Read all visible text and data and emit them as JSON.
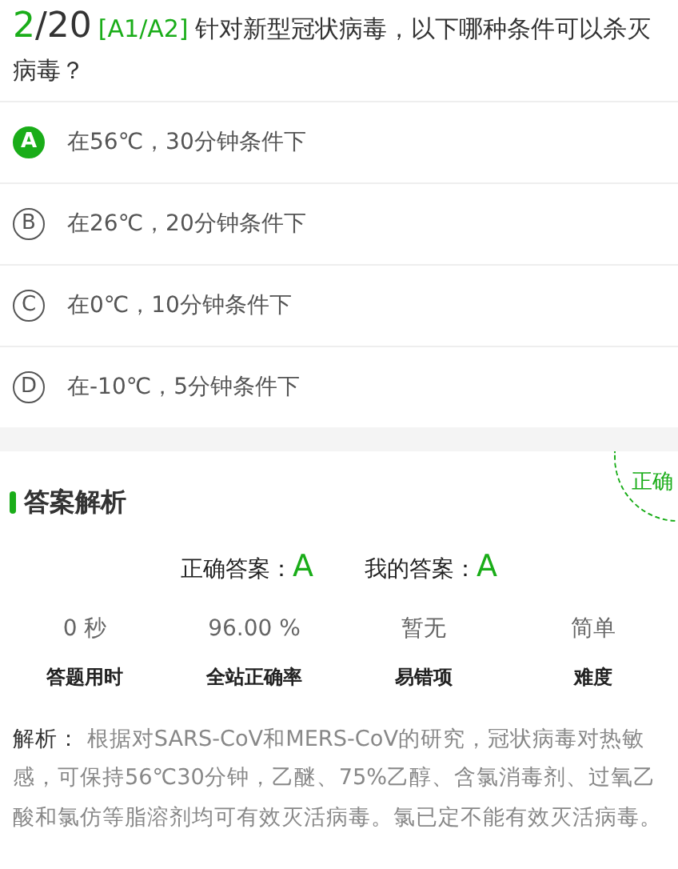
{
  "question": {
    "index": "2",
    "total": "/20",
    "type": "[A1/A2]",
    "text": "针对新型冠状病毒，以下哪种条件可以杀灭病毒？"
  },
  "options": [
    {
      "letter": "A",
      "text": "在56℃，30分钟条件下",
      "selected": true
    },
    {
      "letter": "B",
      "text": "在26℃，20分钟条件下",
      "selected": false
    },
    {
      "letter": "C",
      "text": "在0℃，10分钟条件下",
      "selected": false
    },
    {
      "letter": "D",
      "text": "在-10℃，5分钟条件下",
      "selected": false
    }
  ],
  "analysis": {
    "title": "答案解析",
    "stamp": "正确",
    "correct_label": "正确答案：",
    "correct": "A",
    "mine_label": "我的答案：",
    "mine": "A",
    "stats": [
      {
        "value": "0 秒",
        "label": "答题用时"
      },
      {
        "value": "96.00 %",
        "label": "全站正确率"
      },
      {
        "value": "暂无",
        "label": "易错项"
      },
      {
        "value": "简单",
        "label": "难度"
      }
    ],
    "explain_label": "解析：",
    "explain": "根据对SARS-CoV和MERS-CoV的研究，冠状病毒对热敏感，可保持56℃30分钟，乙醚、75%乙醇、含氯消毒剂、过氧乙酸和氯仿等脂溶剂均可有效灭活病毒。氯已定不能有效灭活病毒。"
  }
}
